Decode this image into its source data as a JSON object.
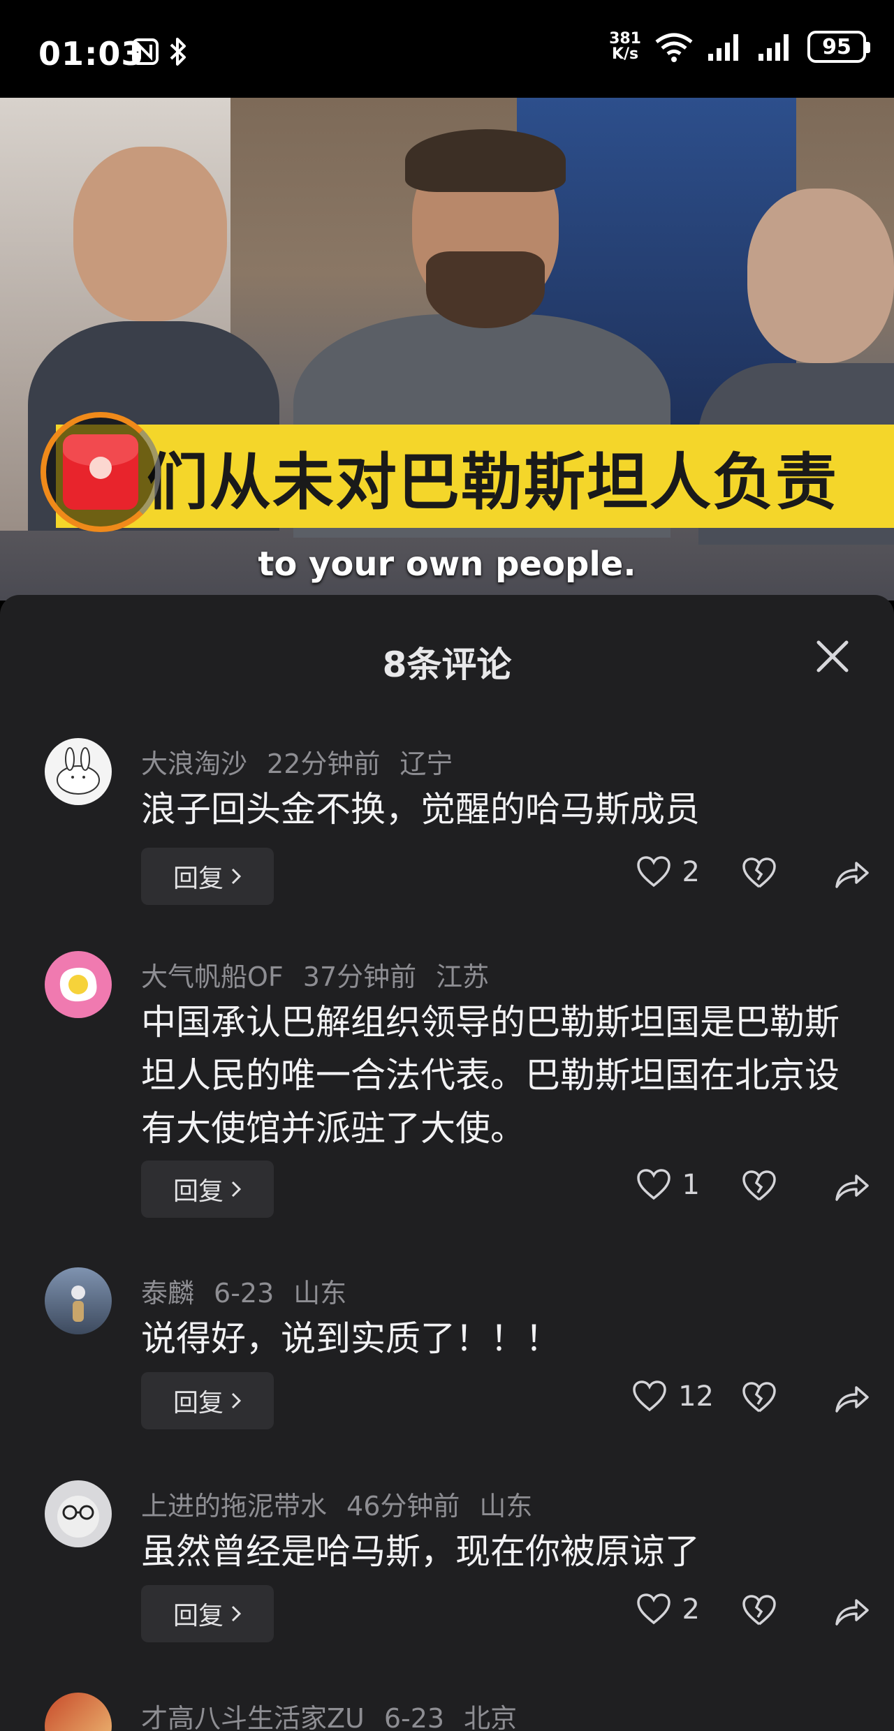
{
  "status_bar": {
    "time": "01:03",
    "net_speed_value": "381",
    "net_speed_unit": "K/s",
    "battery": "95"
  },
  "video": {
    "subtitle_cn": "们从未对巴勒斯坦人负责",
    "subtitle_en": "to your own people."
  },
  "panel": {
    "title": "8条评论"
  },
  "comments": [
    {
      "user": "大浪淘沙",
      "time": "22分钟前",
      "location": "辽宁",
      "text": "浪子回头金不换，觉醒的哈马斯成员",
      "likes": "2",
      "reply_label": "回复"
    },
    {
      "user": "大气帆船OF",
      "time": "37分钟前",
      "location": "江苏",
      "text": "中国承认巴解组织领导的巴勒斯坦国是巴勒斯坦人民的唯一合法代表。巴勒斯坦国在北京设有大使馆并派驻了大使。",
      "likes": "1",
      "reply_label": "回复"
    },
    {
      "user": "泰麟",
      "time": "6-23",
      "location": "山东",
      "text": "说得好，说到实质了！！！",
      "likes": "12",
      "reply_label": "回复"
    },
    {
      "user": "上进的拖泥带水",
      "time": "46分钟前",
      "location": "山东",
      "text": "虽然曾经是哈马斯，现在你被原谅了",
      "likes": "2",
      "reply_label": "回复"
    },
    {
      "user": "才高八斗生活家ZU",
      "time": "6-23",
      "location": "北京"
    }
  ]
}
